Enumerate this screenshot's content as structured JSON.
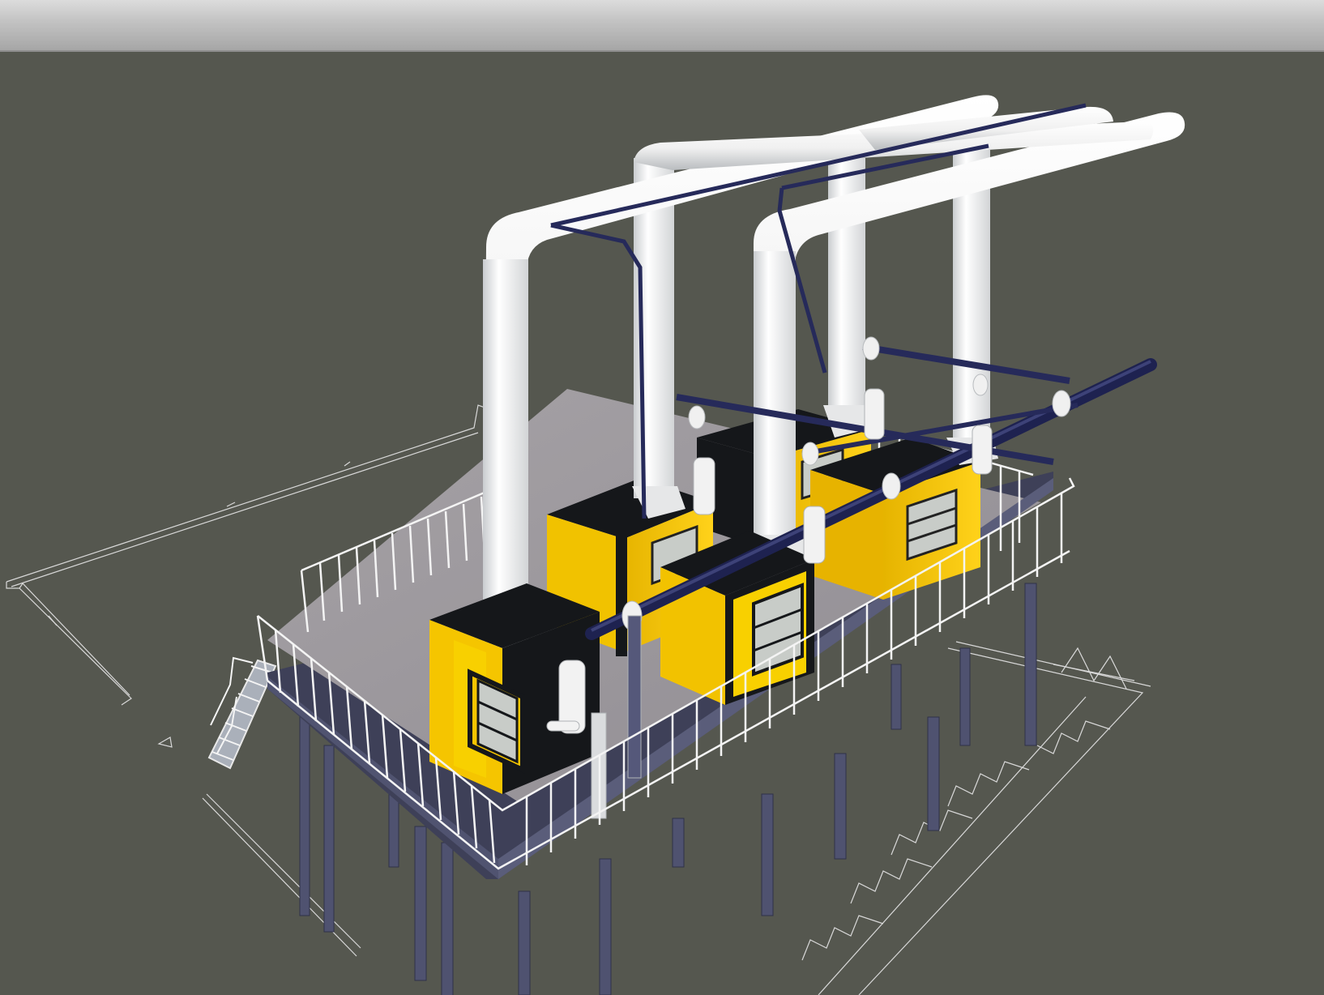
{
  "window": {
    "title": ""
  },
  "viewport": {
    "background": "#55574f"
  },
  "colors": {
    "enclosure_yellow": "#f6c800",
    "enclosure_black": "#15171a",
    "duct_white": "#f2f2f2",
    "pipe_navy": "#262a5a",
    "deck_gray": "#9c989c",
    "column_slate": "#4f5270",
    "railing_white": "#f4f4f4",
    "blueprint_lines": "#d8d8d8"
  },
  "scene": {
    "objects": [
      {
        "name": "compressor-enclosure-1"
      },
      {
        "name": "compressor-enclosure-2"
      },
      {
        "name": "compressor-enclosure-3"
      },
      {
        "name": "compressor-enclosure-4"
      },
      {
        "name": "exhaust-duct"
      },
      {
        "name": "air-header-pipe"
      },
      {
        "name": "elevated-platform"
      },
      {
        "name": "stair"
      },
      {
        "name": "floor-plan-outline"
      }
    ]
  }
}
